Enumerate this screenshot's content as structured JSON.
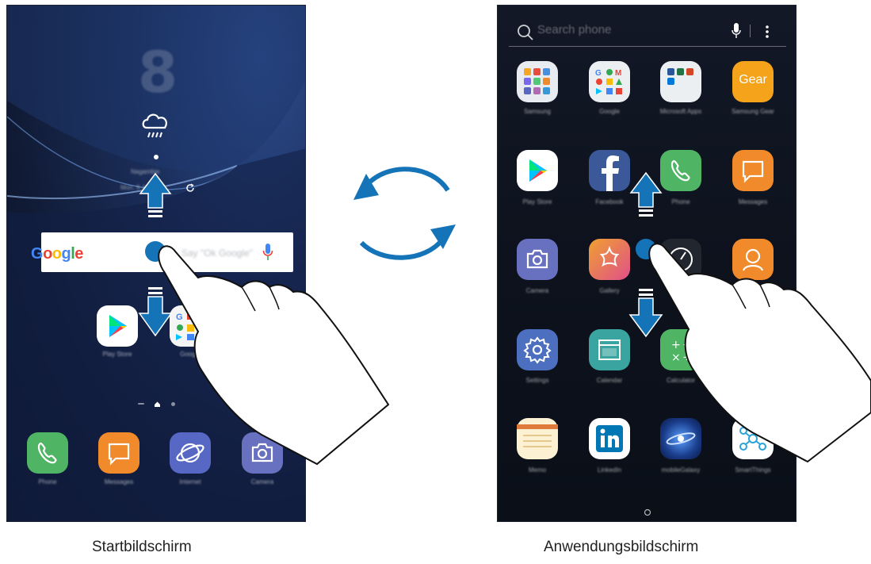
{
  "home": {
    "clock": "8",
    "google_logo": "Google",
    "google_hint": "Say \"Ok Google\"",
    "location": "Nagambie",
    "date": "Mon, 9 Jan",
    "apps": [
      {
        "label": "Play Store",
        "icon": "play-store-icon"
      },
      {
        "label": "Google",
        "icon": "google-folder-icon"
      }
    ],
    "dock": [
      {
        "label": "Phone",
        "icon": "phone-icon",
        "color": "#4fb565"
      },
      {
        "label": "Messages",
        "icon": "messages-icon",
        "color": "#f08a2a"
      },
      {
        "label": "Internet",
        "icon": "internet-icon",
        "color": "#5668c4"
      },
      {
        "label": "Camera",
        "icon": "camera-icon",
        "color": "#6870c0"
      }
    ]
  },
  "apps": {
    "search_placeholder": "Search phone",
    "grid": [
      {
        "label": "Samsung",
        "icon": "samsung-folder-icon"
      },
      {
        "label": "Google",
        "icon": "google-folder-icon"
      },
      {
        "label": "Microsoft Apps",
        "icon": "microsoft-folder-icon"
      },
      {
        "label": "Samsung Gear",
        "icon": "gear-app-icon"
      },
      {
        "label": "Play Store",
        "icon": "play-store-icon"
      },
      {
        "label": "Facebook",
        "icon": "facebook-icon"
      },
      {
        "label": "Phone",
        "icon": "phone-icon"
      },
      {
        "label": "Messages",
        "icon": "messages-icon"
      },
      {
        "label": "Camera",
        "icon": "camera-icon"
      },
      {
        "label": "Gallery",
        "icon": "gallery-icon"
      },
      {
        "label": "Clock",
        "icon": "clock-icon"
      },
      {
        "label": "Contacts",
        "icon": "contacts-icon"
      },
      {
        "label": "Settings",
        "icon": "settings-icon"
      },
      {
        "label": "Calendar",
        "icon": "calendar-icon"
      },
      {
        "label": "Calculator",
        "icon": "calculator-icon"
      },
      {
        "label": "",
        "icon": ""
      },
      {
        "label": "Memo",
        "icon": "memo-icon"
      },
      {
        "label": "LinkedIn",
        "icon": "linkedin-icon"
      },
      {
        "label": "mobileGalaxy",
        "icon": "galaxy-icon"
      },
      {
        "label": "SmartThings",
        "icon": "smartthings-icon"
      }
    ],
    "gear_text": "Gear"
  },
  "captions": {
    "left": "Startbildschirm",
    "right": "Anwendungsbildschirm"
  },
  "colors": {
    "accent_blue": "#1b75bb",
    "arrow_blue": "#1574b8"
  }
}
